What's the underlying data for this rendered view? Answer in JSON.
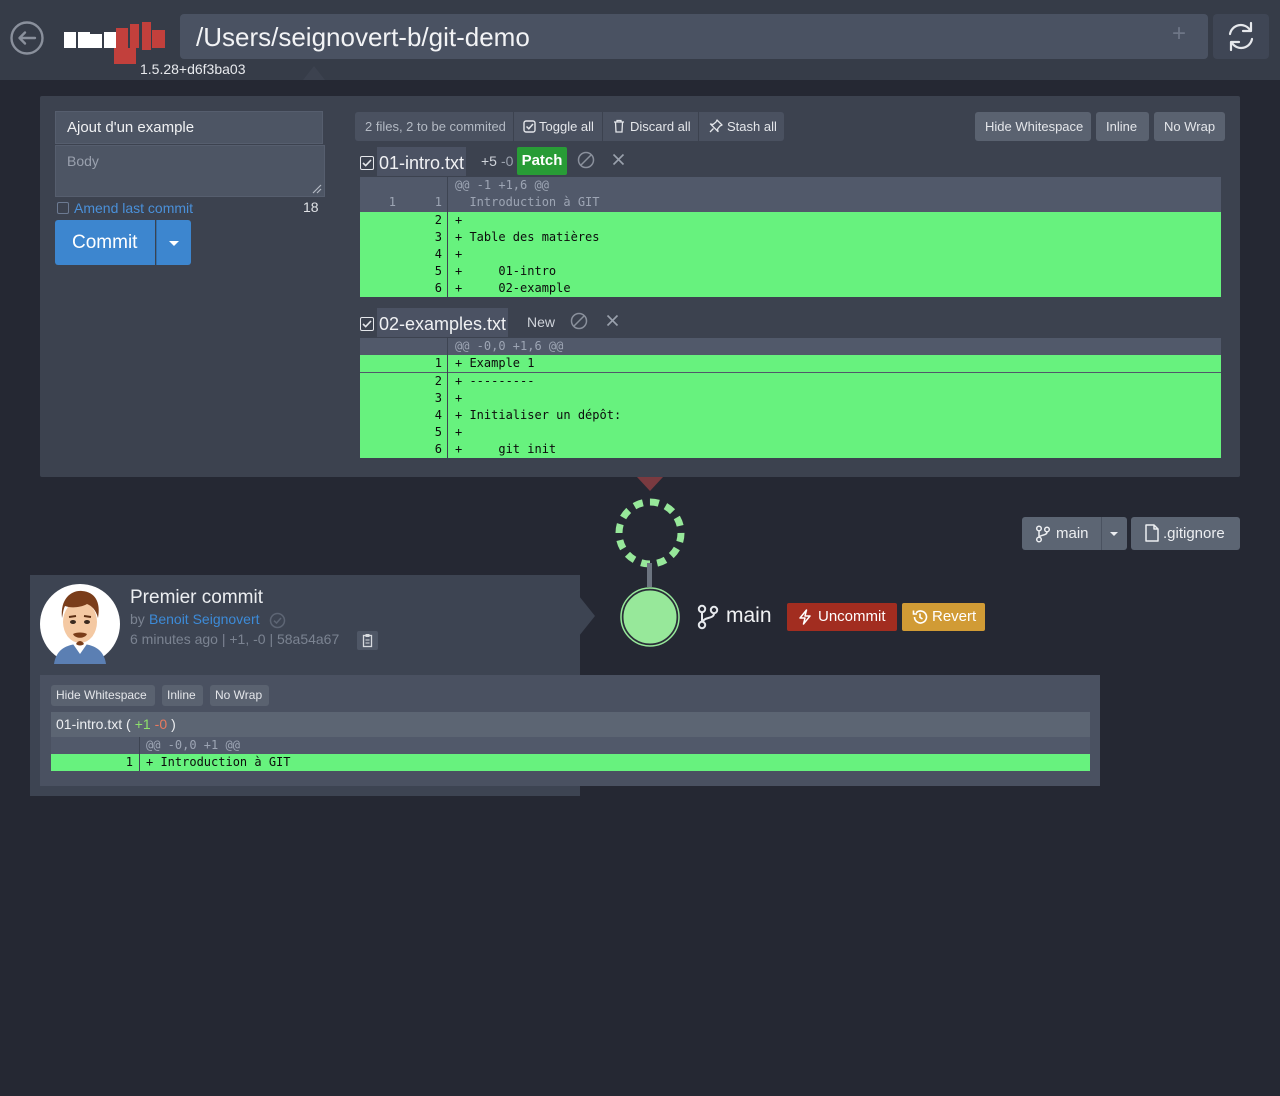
{
  "header": {
    "path": "/Users/seignovert-b/git-demo",
    "version": "1.5.28+d6f3ba03",
    "add_symbol": "+"
  },
  "staging": {
    "commit_title": "Ajout d'un example",
    "body_placeholder": "Body",
    "amend_label": "Amend last commit",
    "char_count": "18",
    "commit_label": "Commit",
    "summary": "2 files, 2 to be commited",
    "toggle_all": "Toggle all",
    "discard_all": "Discard all",
    "stash_all": "Stash all",
    "hide_whitespace": "Hide Whitespace",
    "inline": "Inline",
    "no_wrap": "No Wrap",
    "files": [
      {
        "name": "01-intro.txt",
        "stat_add": "+5",
        "stat_del": "-0",
        "badge": "Patch",
        "hunk": "@@ -1 +1,6 @@",
        "lines": [
          {
            "old": "1",
            "new": "1",
            "type": "ctx",
            "text": "  Introduction à GIT"
          },
          {
            "old": "",
            "new": "2",
            "type": "add",
            "text": "+"
          },
          {
            "old": "",
            "new": "3",
            "type": "add",
            "text": "+ Table des matières"
          },
          {
            "old": "",
            "new": "4",
            "type": "add",
            "text": "+"
          },
          {
            "old": "",
            "new": "5",
            "type": "add",
            "text": "+     01-intro"
          },
          {
            "old": "",
            "new": "6",
            "type": "add",
            "text": "+     02-example"
          }
        ]
      },
      {
        "name": "02-examples.txt",
        "status": "New",
        "hunk": "@@ -0,0 +1,6 @@",
        "lines": [
          {
            "old": "",
            "new": "1",
            "type": "add",
            "text": "+ Example 1"
          },
          {
            "old": "",
            "new": "2",
            "type": "add",
            "text": "+ ---------"
          },
          {
            "old": "",
            "new": "3",
            "type": "add",
            "text": "+"
          },
          {
            "old": "",
            "new": "4",
            "type": "add",
            "text": "+ Initialiser un dépôt:"
          },
          {
            "old": "",
            "new": "5",
            "type": "add",
            "text": "+"
          },
          {
            "old": "",
            "new": "6",
            "type": "add",
            "text": "+     git init"
          }
        ]
      }
    ]
  },
  "graph": {
    "branch": "main",
    "uncommit": "Uncommit",
    "revert": "Revert",
    "branch_pill": "main",
    "gitignore": ".gitignore",
    "colors": {
      "node": "#97e89a",
      "uncommit": "#a22d20",
      "revert": "#d19b35"
    }
  },
  "commit": {
    "title": "Premier commit",
    "by": "by",
    "author": "Benoit Seignovert",
    "meta": "6 minutes ago | +1, -0 | 58a54a67",
    "hide_whitespace": "Hide Whitespace",
    "inline": "Inline",
    "no_wrap": "No Wrap",
    "file_name": "01-intro.txt (",
    "file_add": "+1",
    "file_del": "-0",
    "file_close": ")",
    "hunk": "@@ -0,0 +1 @@",
    "line_num": "1",
    "line_text": "+ Introduction à GIT"
  }
}
